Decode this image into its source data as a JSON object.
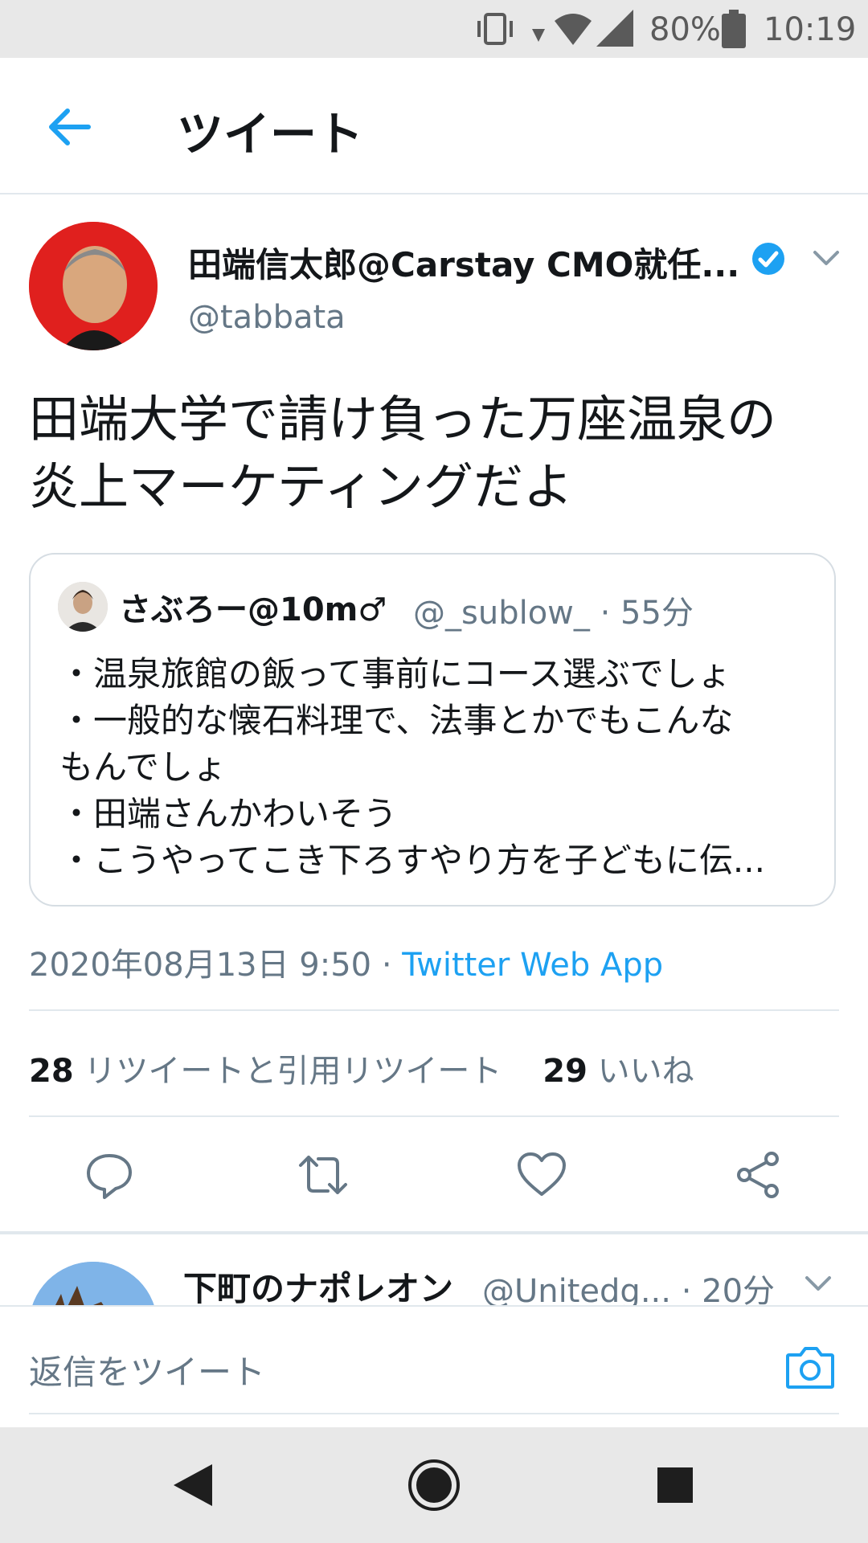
{
  "status_bar": {
    "battery": "80%",
    "time": "10:19"
  },
  "header": {
    "title": "ツイート"
  },
  "tweet": {
    "author_name": "田端信太郎@Carstay CMO就任...",
    "author_handle": "@tabbata",
    "text": "田端大学で請け負った万座温泉の\n炎上マーケティングだよ",
    "quoted": {
      "name": "さぶろー@10m♂",
      "handle": "@_sublow_",
      "time": "55分",
      "text": "・温泉旅館の飯って事前にコース選ぶでしょ\n・一般的な懐石料理で、法事とかでもこんな\nもんでしょ\n・田端さんかわいそう\n・こうやってこき下ろすやり方を子どもに伝..."
    },
    "date": "2020年08月13日 9:50",
    "separator": "·",
    "source": "Twitter Web App",
    "retweet_count": "28",
    "retweet_label": "リツイートと引用リツイート",
    "like_count": "29",
    "like_label": "いいね"
  },
  "reply_preview": {
    "name": "下町のナポレオン",
    "handle": "@Unitedg...",
    "time": "· 20分"
  },
  "composer": {
    "placeholder": "返信をツイート"
  },
  "colors": {
    "accent": "#1da1f2",
    "verified": "#1da1f2",
    "secondary_text": "#657786"
  },
  "icons": [
    "vibrate-icon",
    "wifi-icon",
    "signal-icon",
    "battery-icon",
    "back-arrow-icon",
    "verified-badge-icon",
    "chevron-down-icon",
    "reply-icon",
    "retweet-icon",
    "like-icon",
    "share-icon",
    "camera-icon",
    "nav-back-icon",
    "nav-home-icon",
    "nav-recents-icon"
  ]
}
